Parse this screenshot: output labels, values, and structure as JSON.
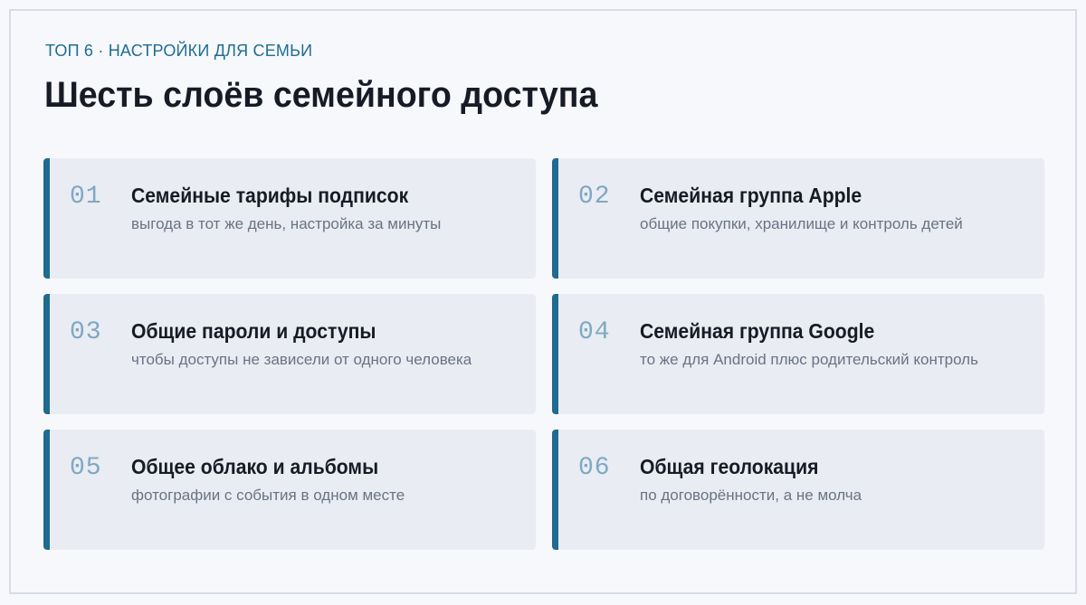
{
  "header": {
    "eyebrow": "ТОП 6 · НАСТРОЙКИ ДЛЯ СЕМЬИ",
    "title": "Шесть слоёв семейного доступа"
  },
  "cards": [
    {
      "num": "01",
      "title": "Семейные тарифы подписок",
      "subtitle": "выгода в тот же день, настройка за минуты"
    },
    {
      "num": "02",
      "title": "Семейная группа Apple",
      "subtitle": "общие покупки, хранилище и контроль детей"
    },
    {
      "num": "03",
      "title": "Общие пароли и доступы",
      "subtitle": "чтобы доступы не зависели от одного человека"
    },
    {
      "num": "04",
      "title": "Семейная группа Google",
      "subtitle": "то же для Android плюс родительский контроль"
    },
    {
      "num": "05",
      "title": "Общее облако и альбомы",
      "subtitle": "фотографии с события в одном месте"
    },
    {
      "num": "06",
      "title": "Общая геолокация",
      "subtitle": "по договорённости, а не молча"
    }
  ],
  "colors": {
    "accent": "#1f6a90",
    "eyebrow": "#1e6d93",
    "number": "#7fa8c3",
    "card_bg": "#e9ecf2",
    "title": "#161b26",
    "subtitle": "#6a7285"
  }
}
